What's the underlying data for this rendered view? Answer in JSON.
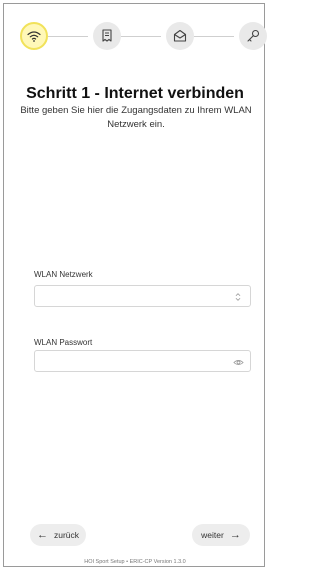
{
  "steps": [
    {
      "icon": "wifi-icon",
      "active": true
    },
    {
      "icon": "document-icon",
      "active": false
    },
    {
      "icon": "mail-icon",
      "active": false
    },
    {
      "icon": "key-icon",
      "active": false
    }
  ],
  "header": {
    "title": "Schritt 1 - Internet verbinden",
    "subtitle": "Bitte geben Sie hier die Zugangsdaten zu Ihrem WLAN Netzwerk ein."
  },
  "form": {
    "network": {
      "label": "WLAN Netzwerk",
      "value": "",
      "icon": "chevron-updown-icon"
    },
    "password": {
      "label": "WLAN Passwort",
      "value": "",
      "icon": "eye-icon"
    }
  },
  "nav": {
    "back_label": "zurück",
    "back_arrow": "←",
    "next_label": "weiter",
    "next_arrow": "→"
  },
  "footer": {
    "text": "HOI Sport Setup • ERIC-CP Version 1.3.0"
  },
  "colors": {
    "active_step_bg": "#fff8b8",
    "active_step_border": "#f1e25a",
    "inactive_step_bg": "#e9e9e9"
  }
}
